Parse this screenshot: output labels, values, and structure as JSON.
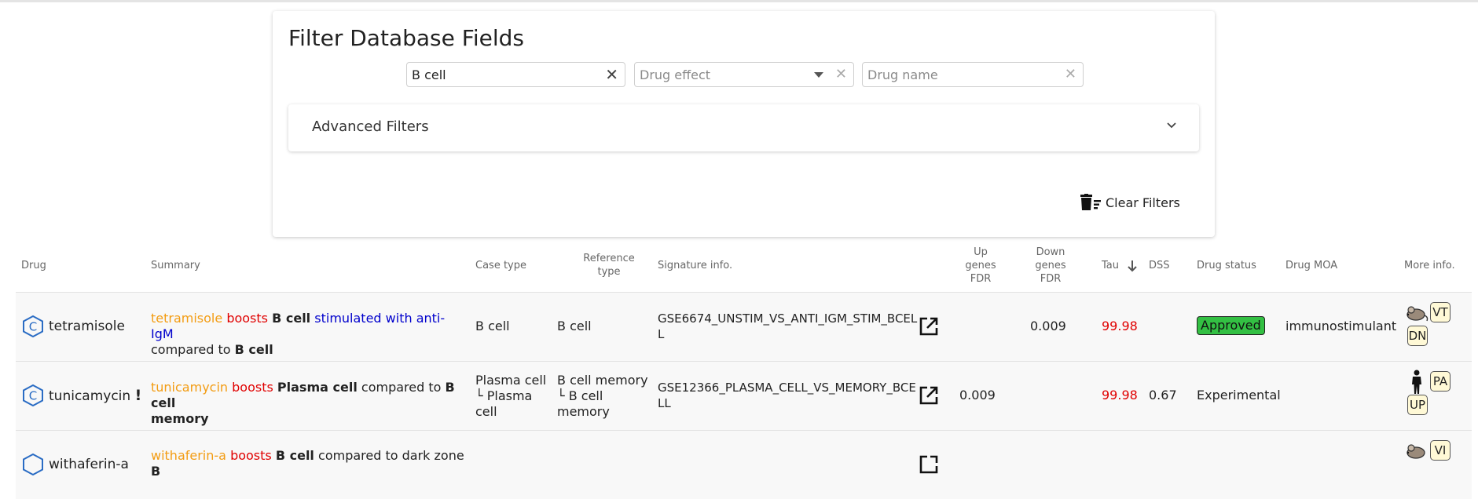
{
  "filter_panel": {
    "title": "Filter Database Fields",
    "cell_type_value": "B cell",
    "drug_effect_placeholder": "Drug effect",
    "drug_name_placeholder": "Drug name",
    "advanced_filters_label": "Advanced Filters",
    "clear_filters_label": "Clear Filters"
  },
  "table": {
    "headers": {
      "drug": "Drug",
      "summary": "Summary",
      "case_type": "Case type",
      "reference_type_1": "Reference",
      "reference_type_2": "type",
      "signature_info": "Signature info.",
      "up_fdr_1": "Up",
      "up_fdr_2": "genes",
      "up_fdr_3": "FDR",
      "down_fdr_1": "Down",
      "down_fdr_2": "genes",
      "down_fdr_3": "FDR",
      "tau": "Tau",
      "dss": "DSS",
      "drug_status": "Drug status",
      "drug_moa": "Drug MOA",
      "more_info": "More info."
    },
    "sort": {
      "column": "Tau",
      "direction": "descending",
      "icon": "arrow-down-icon"
    },
    "rows": [
      {
        "drug": "tetramisole",
        "summary": {
          "drug": "tetramisole",
          "verb": "boosts",
          "case": "B cell",
          "modifier": "stimulated with anti-IgM",
          "compared": "compared to",
          "reference": "B cell"
        },
        "case_type": "B cell",
        "reference_type": "B cell",
        "signature_1": "GSE6674_UNSTIM_VS_ANTI_IGM_STIM_BCEL",
        "signature_2": "L",
        "up_fdr": "",
        "down_fdr": "0.009",
        "tau": "99.98",
        "dss": "",
        "drug_status": "Approved",
        "drug_moa": "immunostimulant",
        "tags": [
          "VT",
          "DN"
        ],
        "species_icon": "mouse-icon"
      },
      {
        "drug": "tunicamycin",
        "warning": "!",
        "summary": {
          "drug": "tunicamycin",
          "verb": "boosts",
          "case": "Plasma cell",
          "compared": "compared to",
          "reference_a": "B cell",
          "reference_b": "memory"
        },
        "case_type_1": "Plasma cell",
        "case_type_2": "└ Plasma",
        "case_type_3": "cell",
        "reference_type_1": "B cell memory",
        "reference_type_2": "└ B cell",
        "reference_type_3": "memory",
        "signature_1": "GSE12366_PLASMA_CELL_VS_MEMORY_BCE",
        "signature_2": "LL",
        "up_fdr": "0.009",
        "down_fdr": "",
        "tau": "99.98",
        "dss": "0.67",
        "drug_status": "Experimental",
        "drug_moa": "",
        "tags": [
          "PA",
          "UP"
        ],
        "species_icon": "human-icon"
      },
      {
        "drug": "withaferin-a",
        "summary": {
          "drug": "withaferin-a",
          "verb": "boosts",
          "case": "B cell",
          "compared": "compared to dark zone",
          "reference": "B"
        },
        "tags": [
          "VI"
        ],
        "species_icon": "mouse-icon"
      }
    ]
  }
}
